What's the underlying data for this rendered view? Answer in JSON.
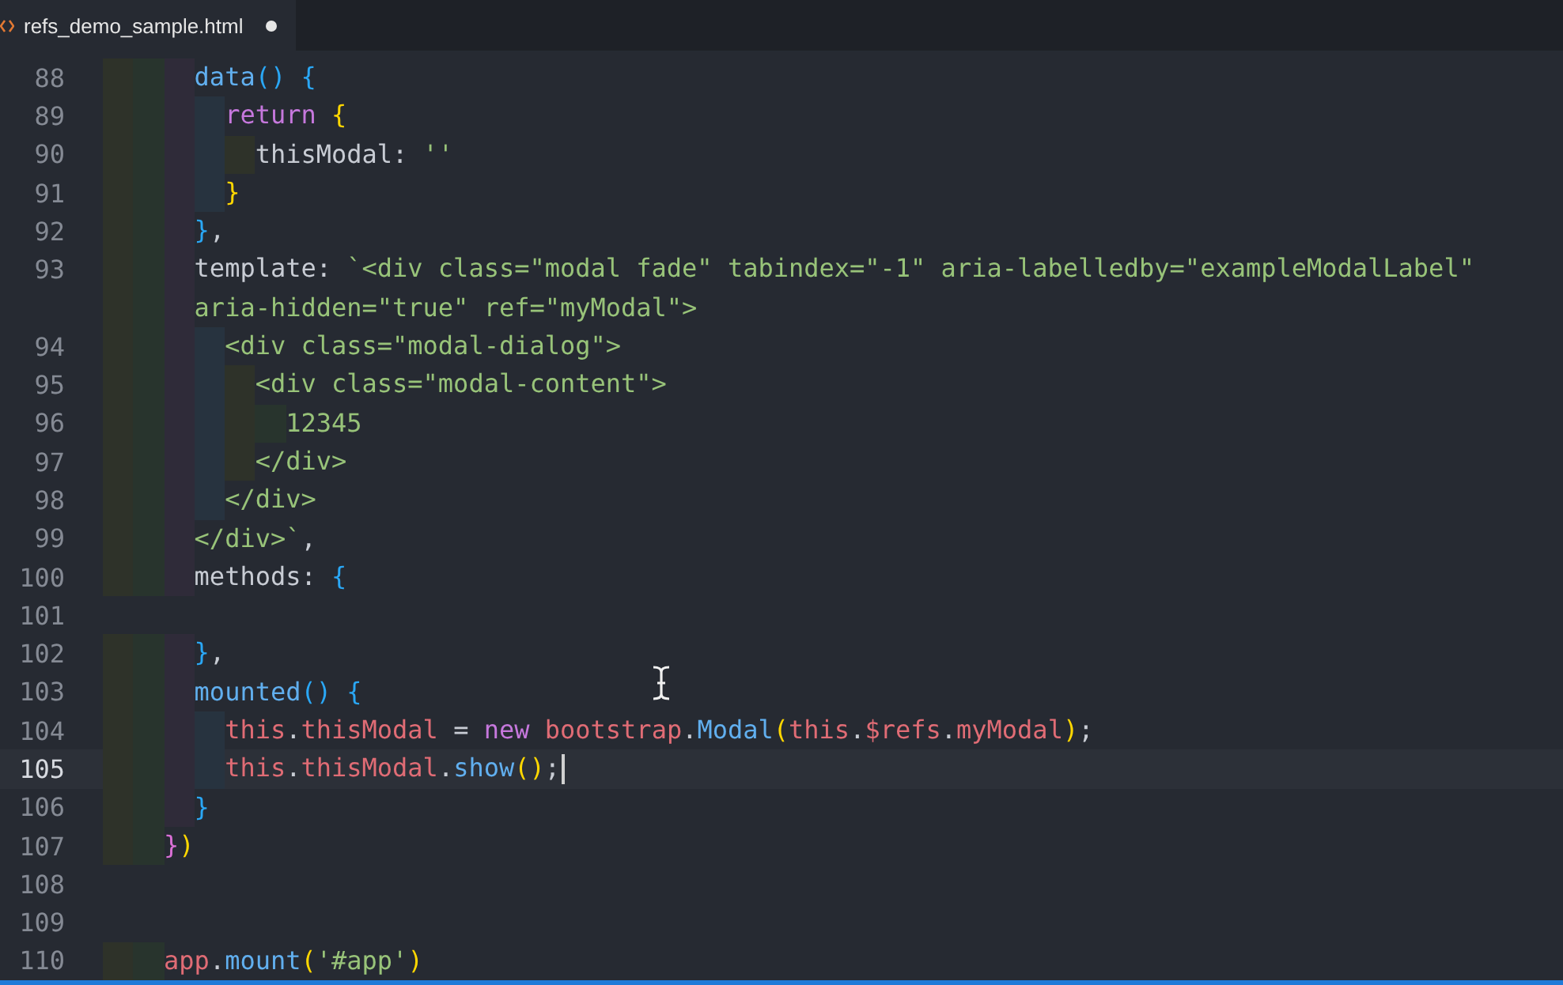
{
  "tab": {
    "title": "refs_demo_sample.html",
    "modified": true
  },
  "lines": [
    {
      "number": "88",
      "current": false,
      "tokens": [
        {
          "kind": "fn",
          "text": "      data"
        },
        {
          "kind": "blue",
          "text": "()"
        },
        {
          "kind": "blue",
          "text": " {"
        }
      ]
    },
    {
      "number": "89",
      "current": false,
      "tokens": [
        {
          "kind": "kw",
          "text": "        return"
        },
        {
          "kind": "yellow",
          "text": " {"
        }
      ]
    },
    {
      "number": "90",
      "current": false,
      "tokens": [
        {
          "kind": "plain",
          "text": "          thisModal: "
        },
        {
          "kind": "str",
          "text": "''"
        }
      ]
    },
    {
      "number": "91",
      "current": false,
      "tokens": [
        {
          "kind": "yellow",
          "text": "        }"
        }
      ]
    },
    {
      "number": "92",
      "current": false,
      "tokens": [
        {
          "kind": "blue",
          "text": "      }"
        },
        {
          "kind": "plain",
          "text": ","
        }
      ]
    },
    {
      "number": "93",
      "current": false,
      "tokens": [
        {
          "kind": "plain",
          "text": "      template: "
        },
        {
          "kind": "str",
          "text": "`<div class=\"modal fade\" tabindex=\"-1\" aria-labelledby=\"exampleModalLabel\""
        }
      ]
    },
    {
      "current": false,
      "tokens": [
        {
          "kind": "str",
          "text": "      aria-hidden=\"true\" ref=\"myModal\">"
        }
      ]
    },
    {
      "number": "94",
      "current": false,
      "tokens": [
        {
          "kind": "str",
          "text": "        <div class=\"modal-dialog\">"
        }
      ]
    },
    {
      "number": "95",
      "current": false,
      "tokens": [
        {
          "kind": "str",
          "text": "          <div class=\"modal-content\">"
        }
      ]
    },
    {
      "number": "96",
      "current": false,
      "tokens": [
        {
          "kind": "str",
          "text": "            12345"
        }
      ]
    },
    {
      "number": "97",
      "current": false,
      "tokens": [
        {
          "kind": "str",
          "text": "          </div>"
        }
      ]
    },
    {
      "number": "98",
      "current": false,
      "tokens": [
        {
          "kind": "str",
          "text": "        </div>"
        }
      ]
    },
    {
      "number": "99",
      "current": false,
      "tokens": [
        {
          "kind": "str",
          "text": "      </div>`"
        },
        {
          "kind": "plain",
          "text": ","
        }
      ]
    },
    {
      "number": "100",
      "current": false,
      "tokens": [
        {
          "kind": "plain",
          "text": "      methods: "
        },
        {
          "kind": "blue",
          "text": "{"
        }
      ]
    },
    {
      "number": "101",
      "current": false
    },
    {
      "number": "102",
      "current": false,
      "tokens": [
        {
          "kind": "blue",
          "text": "      }"
        },
        {
          "kind": "plain",
          "text": ","
        }
      ]
    },
    {
      "number": "103",
      "current": false,
      "tokens": [
        {
          "kind": "fn",
          "text": "      mounted"
        },
        {
          "kind": "blue",
          "text": "()"
        },
        {
          "kind": "blue",
          "text": " {"
        }
      ]
    },
    {
      "number": "104",
      "current": false,
      "tokens": [
        {
          "kind": "var",
          "text": "        this"
        },
        {
          "kind": "plain",
          "text": "."
        },
        {
          "kind": "var",
          "text": "thisModal"
        },
        {
          "kind": "plain",
          "text": " = "
        },
        {
          "kind": "kw",
          "text": "new"
        },
        {
          "kind": "var",
          "text": " bootstrap"
        },
        {
          "kind": "plain",
          "text": "."
        },
        {
          "kind": "fn",
          "text": "Modal"
        },
        {
          "kind": "yellow",
          "text": "("
        },
        {
          "kind": "var",
          "text": "this"
        },
        {
          "kind": "plain",
          "text": "."
        },
        {
          "kind": "var",
          "text": "$refs"
        },
        {
          "kind": "plain",
          "text": "."
        },
        {
          "kind": "var",
          "text": "myModal"
        },
        {
          "kind": "yellow",
          "text": ")"
        },
        {
          "kind": "plain",
          "text": ";"
        }
      ]
    },
    {
      "number": "105",
      "current": true,
      "tokens": [
        {
          "kind": "var",
          "text": "        this"
        },
        {
          "kind": "plain",
          "text": "."
        },
        {
          "kind": "var",
          "text": "thisModal"
        },
        {
          "kind": "plain",
          "text": "."
        },
        {
          "kind": "fn",
          "text": "show"
        },
        {
          "kind": "yellow",
          "text": "()"
        },
        {
          "kind": "plain",
          "text": ";"
        }
      ]
    },
    {
      "number": "106",
      "current": false,
      "tokens": [
        {
          "kind": "blue",
          "text": "      }"
        }
      ]
    },
    {
      "number": "107",
      "current": false,
      "tokens": [
        {
          "kind": "pink",
          "text": "    }"
        },
        {
          "kind": "yellow",
          "text": ")"
        }
      ]
    },
    {
      "number": "108",
      "current": false
    },
    {
      "number": "109",
      "current": false
    },
    {
      "number": "110",
      "current": false,
      "tokens": [
        {
          "kind": "var",
          "text": "    app"
        },
        {
          "kind": "plain",
          "text": "."
        },
        {
          "kind": "fn",
          "text": "mount"
        },
        {
          "kind": "yellow",
          "text": "("
        },
        {
          "kind": "str",
          "text": "'#app'"
        },
        {
          "kind": "yellow",
          "text": ")"
        }
      ]
    }
  ]
}
